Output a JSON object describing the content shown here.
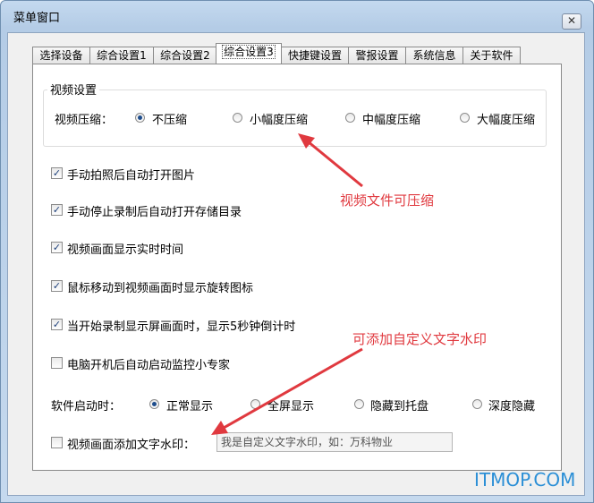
{
  "window": {
    "title": "菜单窗口",
    "close_glyph": "✕"
  },
  "tabs": [
    {
      "label": "选择设备",
      "active": false
    },
    {
      "label": "综合设置1",
      "active": false
    },
    {
      "label": "综合设置2",
      "active": false
    },
    {
      "label": "综合设置3",
      "active": true
    },
    {
      "label": "快捷键设置",
      "active": false
    },
    {
      "label": "警报设置",
      "active": false
    },
    {
      "label": "系统信息",
      "active": false
    },
    {
      "label": "关于软件",
      "active": false
    }
  ],
  "video_group": {
    "title": "视频设置",
    "compression_label": "视频压缩：",
    "options": [
      {
        "label": "不压缩",
        "selected": true
      },
      {
        "label": "小幅度压缩",
        "selected": false
      },
      {
        "label": "中幅度压缩",
        "selected": false
      },
      {
        "label": "大幅度压缩",
        "selected": false
      }
    ]
  },
  "checkboxes": [
    {
      "label": "手动拍照后自动打开图片",
      "checked": true
    },
    {
      "label": "手动停止录制后自动打开存储目录",
      "checked": true
    },
    {
      "label": "视频画面显示实时时间",
      "checked": true
    },
    {
      "label": "鼠标移动到视频画面时显示旋转图标",
      "checked": true
    },
    {
      "label": "当开始录制显示屏画面时，显示5秒钟倒计时",
      "checked": true
    },
    {
      "label": "电脑开机后自动启动监控小专家",
      "checked": false
    }
  ],
  "startup": {
    "label": "软件启动时：",
    "options": [
      {
        "label": "正常显示",
        "selected": true
      },
      {
        "label": "全屏显示",
        "selected": false
      },
      {
        "label": "隐藏到托盘",
        "selected": false
      },
      {
        "label": "深度隐藏",
        "selected": false
      }
    ]
  },
  "watermark_option": {
    "label": "视频画面添加文字水印：",
    "checked": false,
    "placeholder": "我是自定义文字水印，如：万科物业"
  },
  "annotations": {
    "compress": "视频文件可压缩",
    "watermark": "可添加自定义文字水印",
    "color": "#e0393f"
  },
  "site_watermark": "ITMOP.COM"
}
